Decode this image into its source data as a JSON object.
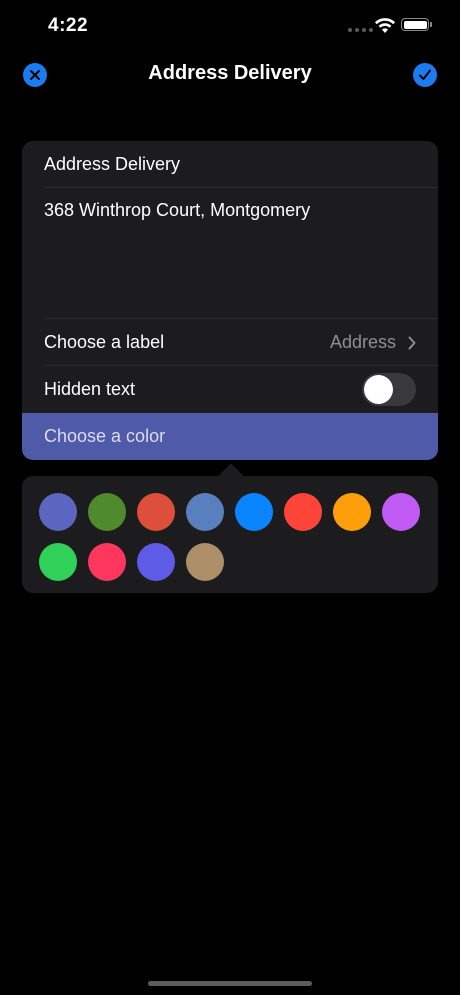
{
  "status_bar": {
    "time": "4:22"
  },
  "nav": {
    "title": "Address Delivery",
    "close_icon": "close-icon",
    "done_icon": "checkmark-icon",
    "accent_color": "#1a7cf0"
  },
  "form": {
    "title_value": "Address Delivery",
    "address_value": "368 Winthrop Court, Montgomery",
    "label_row": {
      "label": "Choose a label",
      "value": "Address"
    },
    "hidden_text_row": {
      "label": "Hidden text",
      "enabled": false
    },
    "color_row": {
      "label": "Choose a color",
      "highlight_color": "#4f5aa8"
    }
  },
  "color_options": [
    "#5c65c0",
    "#4f8a2f",
    "#dd4f3a",
    "#5a7fbe",
    "#0a84ff",
    "#ff453a",
    "#ff9f0a",
    "#bf5af2",
    "#30d158",
    "#ff375f",
    "#5e5ce6",
    "#ac8e68"
  ]
}
